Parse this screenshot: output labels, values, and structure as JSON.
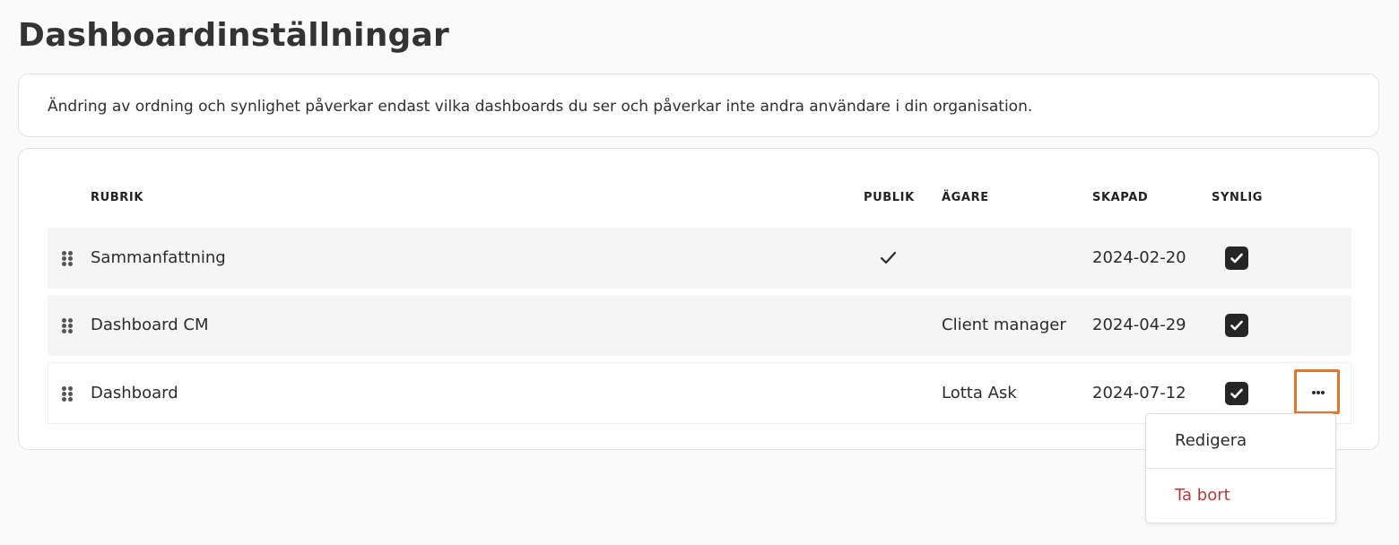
{
  "page": {
    "title": "Dashboardinställningar",
    "info_text": "Ändring av ordning och synlighet påverkar endast vilka dashboards du ser och påverkar inte andra användare i din organisation."
  },
  "table": {
    "headers": {
      "title": "RUBRIK",
      "public": "PUBLIK",
      "owner": "ÄGARE",
      "created": "SKAPAD",
      "visible": "SYNLIG"
    },
    "rows": [
      {
        "title": "Sammanfattning",
        "public": true,
        "owner": "",
        "created": "2024-02-20",
        "visible": true
      },
      {
        "title": "Dashboard CM",
        "public": false,
        "owner": "Client manager",
        "created": "2024-04-29",
        "visible": true
      },
      {
        "title": "Dashboard",
        "public": false,
        "owner": "Lotta Ask",
        "created": "2024-07-12",
        "visible": true
      }
    ]
  },
  "row_menu": {
    "items": [
      {
        "label": "Redigera",
        "color": "#2b2b2b"
      },
      {
        "label": "Ta bort",
        "color": "#b23a3a"
      }
    ]
  },
  "icons": {
    "drag_handle": "drag-handle-icon",
    "public_check": "check-icon",
    "visible_checkbox": "checkbox-checked-icon",
    "more": "ellipsis-icon"
  },
  "colors": {
    "checkbox": "#262626",
    "focus_outline": "#e0792f",
    "danger": "#b23a3a",
    "row_alt": "#f5f5f5"
  }
}
